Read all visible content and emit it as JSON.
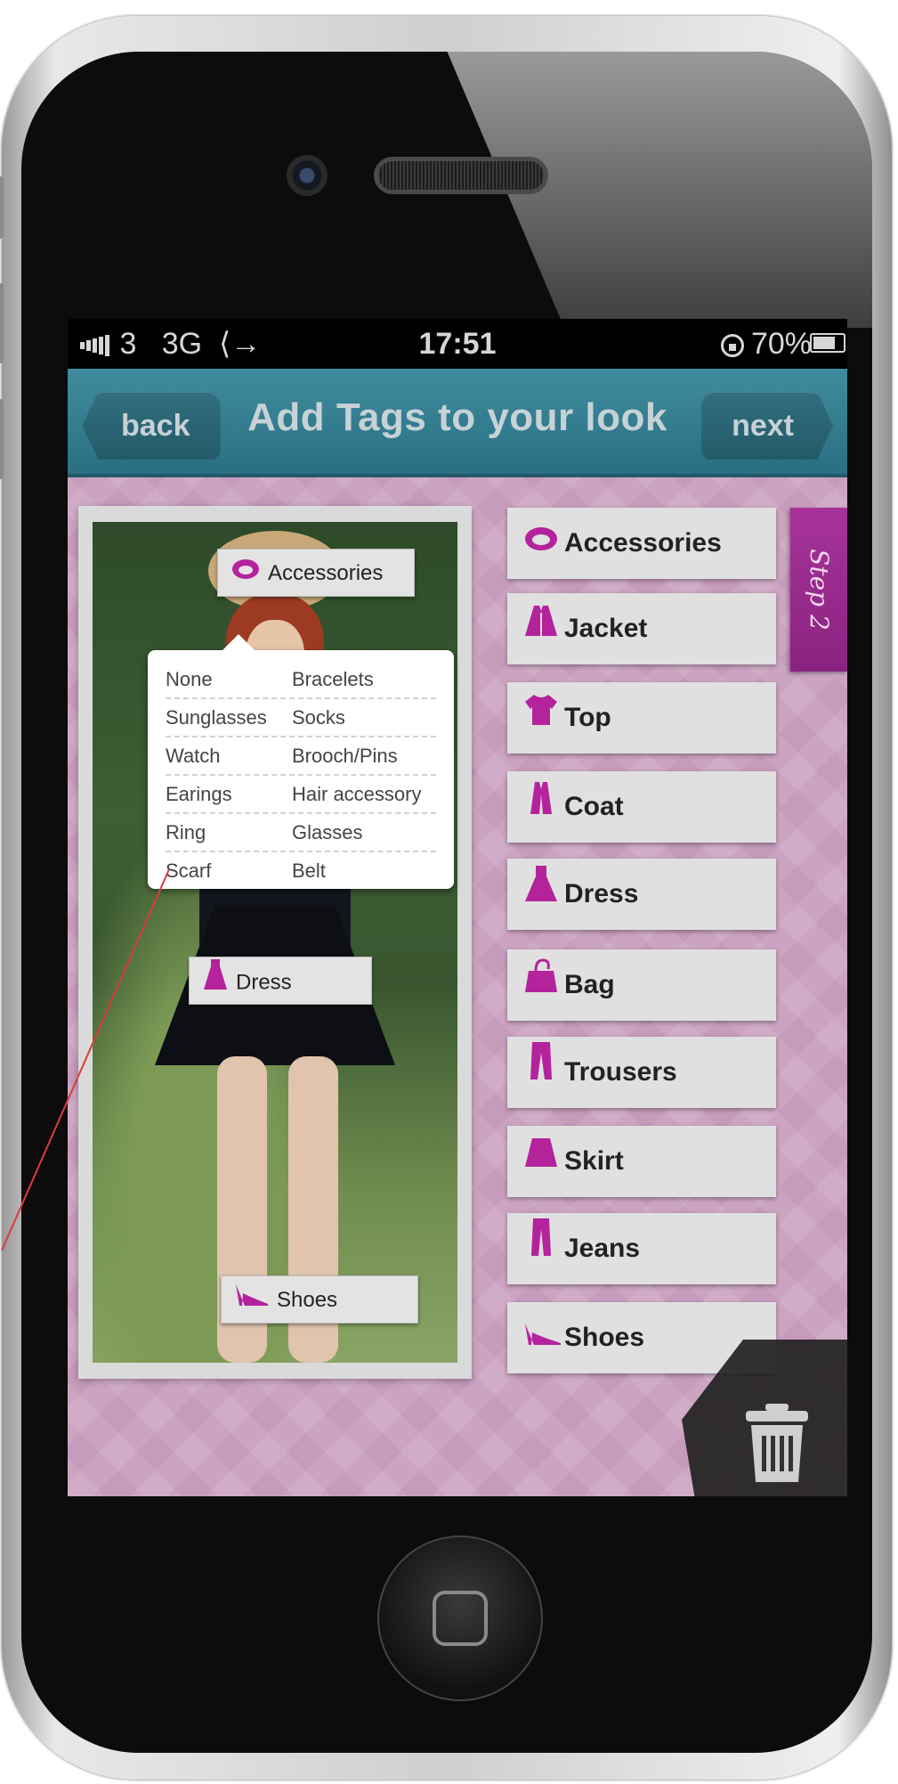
{
  "status_bar": {
    "signal_text": "3",
    "network": "3G",
    "time": "17:51",
    "battery": "70%"
  },
  "nav": {
    "title": "Add Tags to your look",
    "back_label": "back",
    "next_label": "next"
  },
  "step_label": "Step 2",
  "photo_tags": [
    {
      "label": "Accessories",
      "icon": "accessories-icon"
    },
    {
      "label": "Dress",
      "icon": "dress-icon"
    },
    {
      "label": "Shoes",
      "icon": "shoes-icon"
    }
  ],
  "popup": {
    "rows": [
      [
        "None",
        "Bracelets"
      ],
      [
        "Sunglasses",
        "Socks"
      ],
      [
        "Watch",
        "Brooch/Pins"
      ],
      [
        "Earings",
        "Hair accessory"
      ],
      [
        "Ring",
        "Glasses"
      ],
      [
        "Scarf",
        "Belt"
      ]
    ]
  },
  "categories": [
    {
      "label": "Accessories",
      "icon": "accessories-icon"
    },
    {
      "label": "Jacket",
      "icon": "jacket-icon"
    },
    {
      "label": "Top",
      "icon": "top-icon"
    },
    {
      "label": "Coat",
      "icon": "coat-icon"
    },
    {
      "label": "Dress",
      "icon": "dress-icon"
    },
    {
      "label": "Bag",
      "icon": "bag-icon"
    },
    {
      "label": "Trousers",
      "icon": "trousers-icon"
    },
    {
      "label": "Skirt",
      "icon": "skirt-icon"
    },
    {
      "label": "Jeans",
      "icon": "jeans-icon"
    },
    {
      "label": "Shoes",
      "icon": "shoes-icon"
    }
  ],
  "colors": {
    "accent": "#b4239c",
    "nav_bar": "#2f7a8c",
    "background": "#c79bbc",
    "step_tab": "#9a2a8f"
  }
}
